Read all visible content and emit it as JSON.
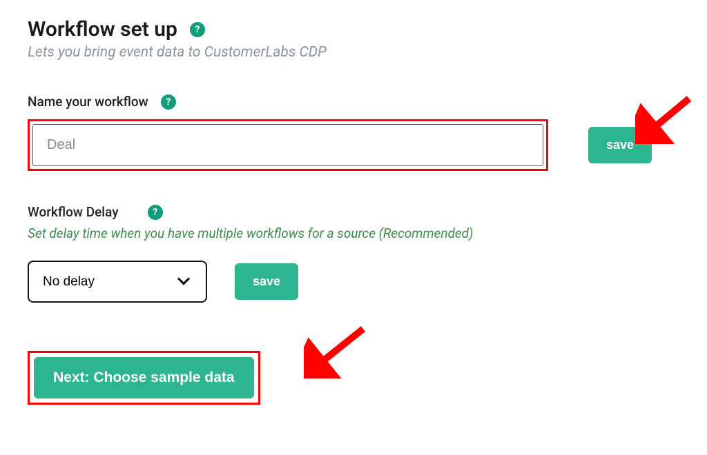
{
  "header": {
    "title": "Workflow set up",
    "help_glyph": "?",
    "subtitle": "Lets you bring event data to CustomerLabs CDP"
  },
  "name_field": {
    "label": "Name your workflow",
    "help_glyph": "?",
    "value": "Deal",
    "save_label": "save"
  },
  "delay_field": {
    "label": "Workflow Delay",
    "help_glyph": "?",
    "description": "Set delay time when you have multiple workflows for a source (Recommended)",
    "selected": "No delay",
    "save_label": "save"
  },
  "next_button": {
    "label": "Next: Choose sample data"
  },
  "colors": {
    "accent": "#2cb58f",
    "help_badge": "#0f9d7a",
    "highlight": "#ff0000",
    "desc_green": "#3a8f4a"
  }
}
